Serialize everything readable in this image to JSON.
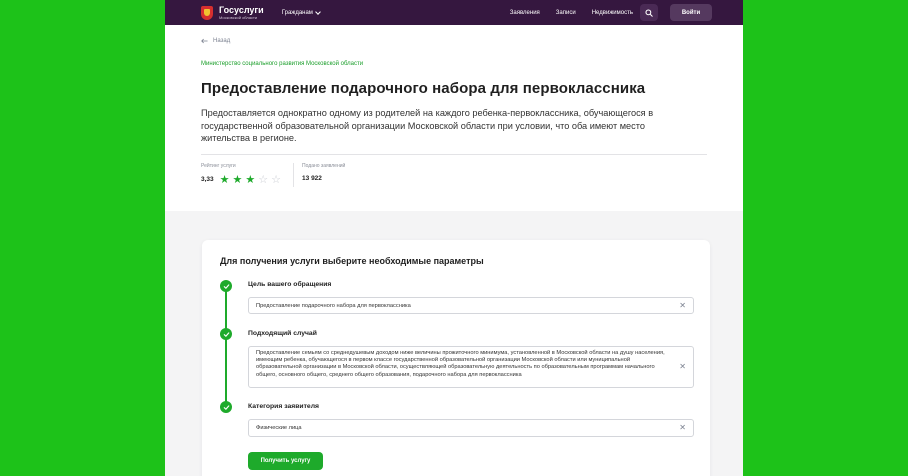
{
  "header": {
    "logo_title": "Госуслуги",
    "logo_sub": "Московской области",
    "citizens_label": "Гражданам",
    "nav": [
      "Заявления",
      "Записи",
      "Недвижимость"
    ],
    "login_label": "Войти"
  },
  "hero": {
    "back_label": "Назад",
    "ministry": "Министерство социального развития Московской области",
    "title": "Предоставление подарочного набора для первоклассника",
    "description": "Предоставляется однократно одному из родителей на каждого ребенка-первоклассника, обучающегося в государственной образовательной организации Московской области при условии, что оба имеют место жительства в регионе.",
    "rating_label": "Рейтинг услуги",
    "rating_value": "3,33",
    "rating_stars": 3,
    "rating_max": 5,
    "applications_label": "Подано заявлений",
    "applications_value": "13 922"
  },
  "form": {
    "title": "Для получения услуги выберите необходимые параметры",
    "steps": [
      {
        "label": "Цель вашего обращения",
        "value": "Предоставление подарочного набора для первоклассника"
      },
      {
        "label": "Подходящий случай",
        "value": "Предоставление семьям со среднедушевым доходом ниже величины прожиточного минимума, установленной в Московской области на душу населения, имеющим ребенка, обучающегося в первом классе государственной образовательной организации Московской области или муниципальной образовательной организации в Московской области, осуществляющей образовательную деятельность по образовательным программам начального общего, основного общего, среднего общего образования, подарочного набора для первоклассника"
      },
      {
        "label": "Категория заявителя",
        "value": "Физические лица"
      }
    ],
    "submit_label": "Получить услугу"
  },
  "colors": {
    "background": "#1dc219",
    "header": "#35173f",
    "accent": "#1eaa2b"
  }
}
